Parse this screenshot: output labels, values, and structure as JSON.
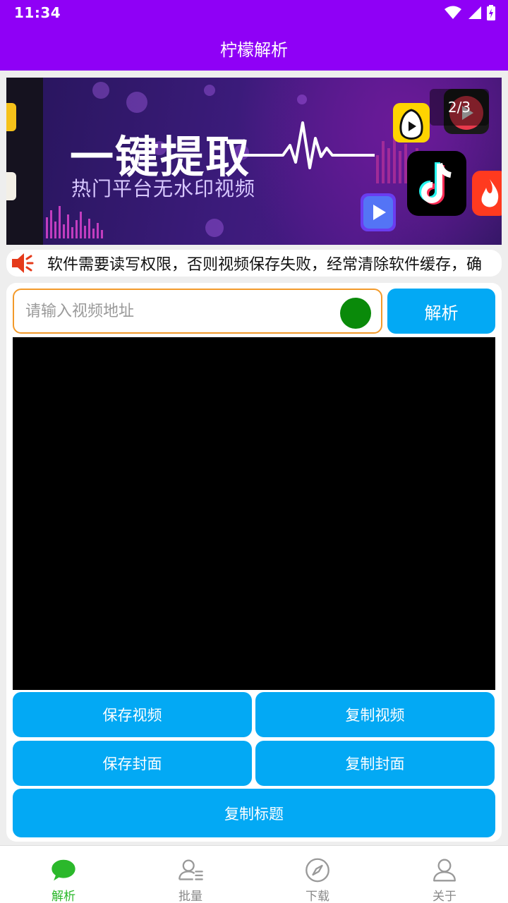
{
  "status_bar": {
    "time": "11:34"
  },
  "app_bar": {
    "title": "柠檬解析"
  },
  "banner": {
    "headline": "一键提取",
    "subtitle": "热门平台无水印视频",
    "counter": "2/3"
  },
  "notice": {
    "text": "软件需要读写权限，否则视频保存失败，经常清除软件缓存，确"
  },
  "url_input": {
    "placeholder": "请输入视频地址",
    "value": ""
  },
  "actions": {
    "parse": "解析",
    "save_video": "保存视频",
    "copy_video": "复制视频",
    "save_cover": "保存封面",
    "copy_cover": "复制封面",
    "copy_title": "复制标题"
  },
  "bottom_nav": [
    {
      "label": "解析",
      "icon": "chat-bubble-icon",
      "active": true
    },
    {
      "label": "批量",
      "icon": "user-list-icon",
      "active": false
    },
    {
      "label": "下载",
      "icon": "compass-icon",
      "active": false
    },
    {
      "label": "关于",
      "icon": "person-icon",
      "active": false
    }
  ],
  "colors": {
    "primary": "#8f00f6",
    "button": "#03a9f4",
    "input_border": "#f39a2a",
    "active_nav": "#2bb82b",
    "indicator": "#0a8a0a"
  }
}
